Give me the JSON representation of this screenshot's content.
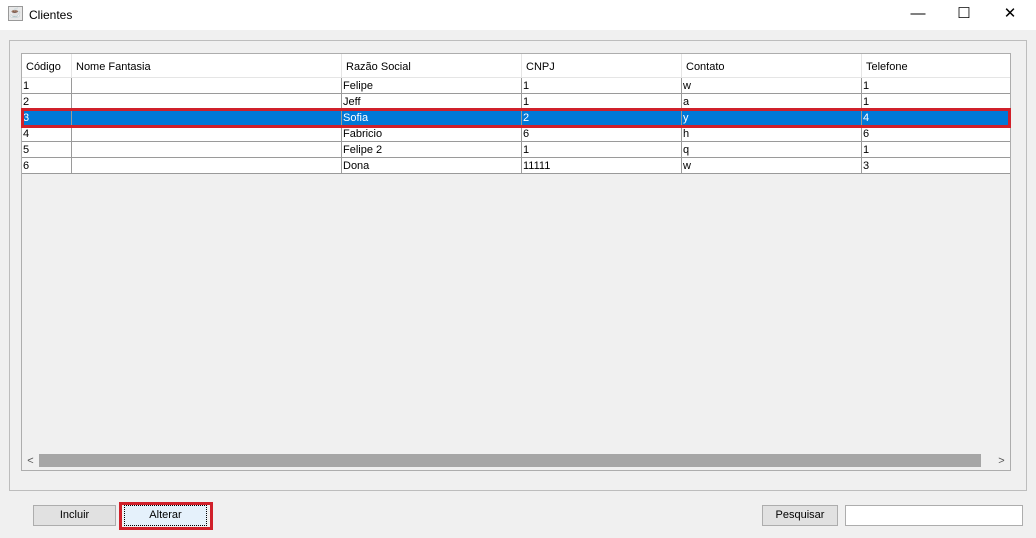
{
  "window": {
    "title": "Clientes",
    "minimize": "—",
    "maximize": "☐",
    "close": "✕"
  },
  "table": {
    "columns": [
      "Código",
      "Nome Fantasia",
      "Razão Social",
      "CNPJ",
      "Contato",
      "Telefone"
    ],
    "rows": [
      [
        "1",
        "",
        "Felipe",
        "1",
        "w",
        "1"
      ],
      [
        "2",
        "",
        "Jeff",
        "1",
        "a",
        "1"
      ],
      [
        "3",
        "",
        "Sofia",
        "2",
        "y",
        "4"
      ],
      [
        "4",
        "",
        "Fabricio",
        "6",
        "h",
        "6"
      ],
      [
        "5",
        "",
        "Felipe 2",
        "1",
        "q",
        "1"
      ],
      [
        "6",
        "",
        "Dona",
        "11111",
        "w",
        "3"
      ]
    ],
    "selected_row": 3
  },
  "buttons": {
    "incluir": "Incluir",
    "alterar": "Alterar",
    "pesquisar": "Pesquisar"
  },
  "search": {
    "value": ""
  },
  "colors": {
    "selection": "#0078d7",
    "highlight": "#d0202a"
  }
}
